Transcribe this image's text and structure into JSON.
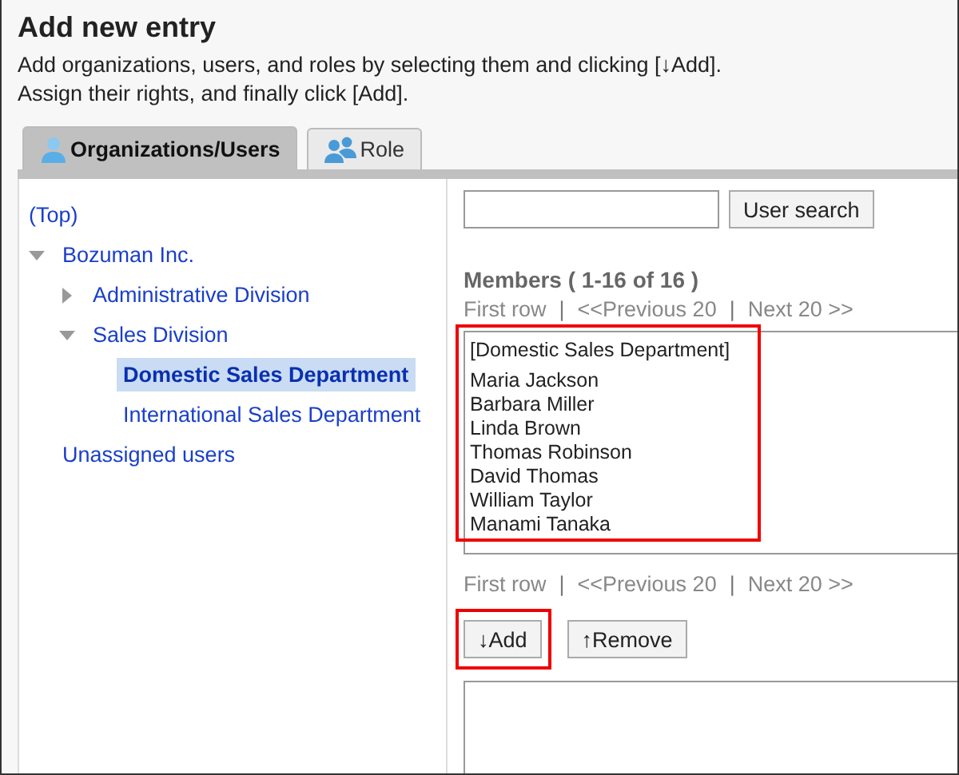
{
  "title": "Add new entry",
  "description": [
    "Add organizations, users, and roles by selecting them and clicking [↓Add].",
    "Assign their rights, and finally click [Add]."
  ],
  "tabs": [
    {
      "label": "Organizations/Users",
      "selected": true
    },
    {
      "label": "Role",
      "selected": false
    }
  ],
  "tree": [
    {
      "label": "(Top)",
      "selected": false,
      "children": [
        {
          "label": "Bozuman Inc.",
          "expanded": true,
          "selected": false,
          "children": [
            {
              "label": "Administrative Division",
              "expanded": false,
              "selected": false
            },
            {
              "label": "Sales Division",
              "expanded": true,
              "selected": false,
              "children": [
                {
                  "label": "Domestic Sales Department",
                  "selected": true
                },
                {
                  "label": "International Sales Department",
                  "selected": false
                }
              ]
            }
          ]
        },
        {
          "label": "Unassigned users",
          "selected": false
        }
      ]
    }
  ],
  "search": {
    "button": "User search"
  },
  "members": {
    "heading": "Members ( 1-16 of 16 )",
    "highlighted": true,
    "pager": [
      "First row",
      "|",
      "<<Previous 20",
      "|",
      "Next 20 >>"
    ],
    "group": "[Domestic Sales Department]",
    "items": [
      "Maria Jackson",
      "Barbara Miller",
      "Linda Brown",
      "Thomas Robinson",
      "David Thomas",
      "William Taylor",
      "Manami Tanaka"
    ]
  },
  "pager_bottom": [
    "First row",
    "|",
    "<<Previous 20",
    "|",
    "Next 20 >>"
  ],
  "buttons": [
    {
      "label": "↓Add",
      "highlighted": true
    },
    {
      "label": "↑Remove",
      "highlighted": false
    }
  ]
}
